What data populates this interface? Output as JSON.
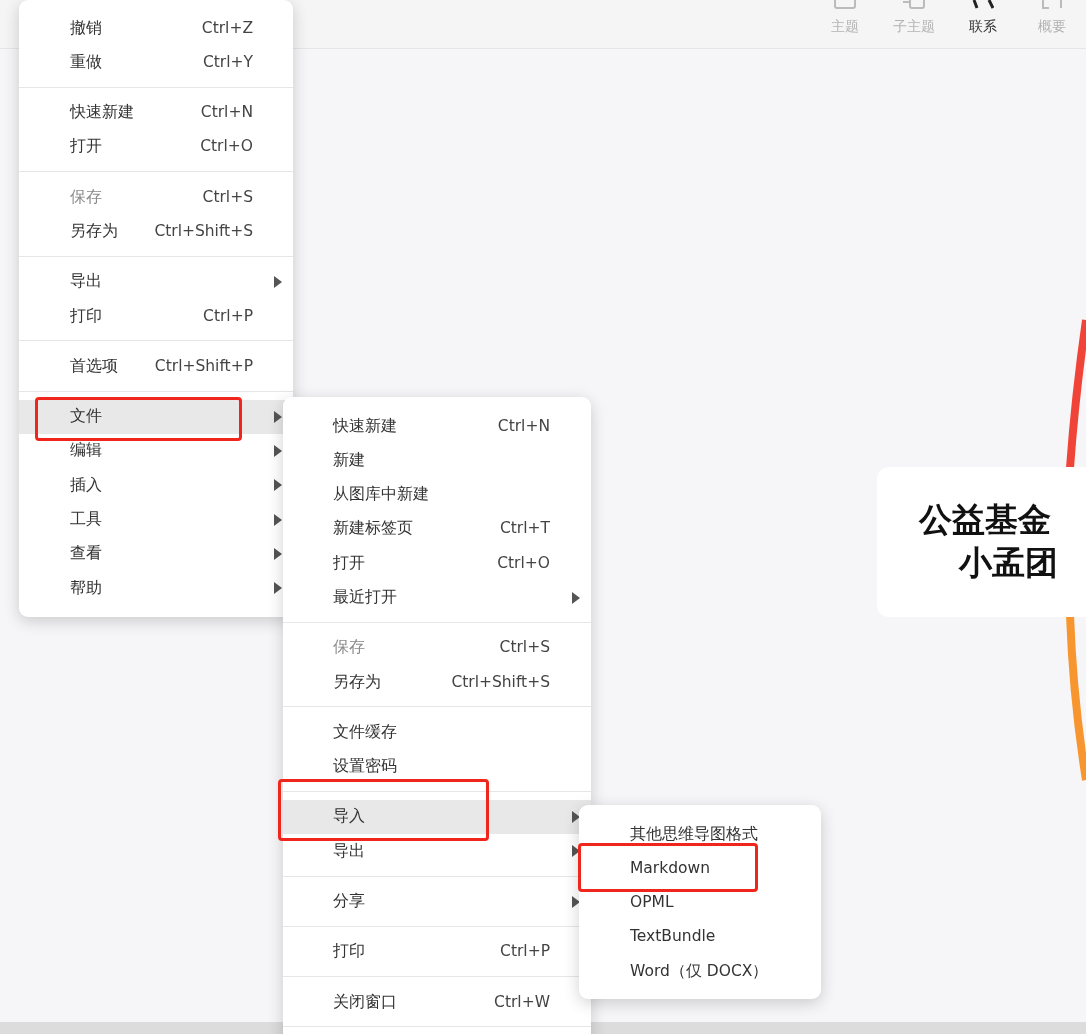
{
  "toolbar": {
    "items": [
      {
        "label": "主题",
        "active": false
      },
      {
        "label": "子主题",
        "active": false
      },
      {
        "label": "联系",
        "active": true
      },
      {
        "label": "概要",
        "active": false
      }
    ]
  },
  "canvas": {
    "node_lines": [
      "公益基金",
      "小孟团"
    ]
  },
  "main_menu": {
    "groups": [
      [
        {
          "label": "撤销",
          "shortcut": "Ctrl+Z",
          "disabled": false,
          "submenu": false,
          "highlighted": false,
          "outlined": false
        },
        {
          "label": "重做",
          "shortcut": "Ctrl+Y",
          "disabled": false,
          "submenu": false,
          "highlighted": false,
          "outlined": false
        }
      ],
      [
        {
          "label": "快速新建",
          "shortcut": "Ctrl+N",
          "disabled": false,
          "submenu": false,
          "highlighted": false,
          "outlined": false
        },
        {
          "label": "打开",
          "shortcut": "Ctrl+O",
          "disabled": false,
          "submenu": false,
          "highlighted": false,
          "outlined": false
        }
      ],
      [
        {
          "label": "保存",
          "shortcut": "Ctrl+S",
          "disabled": true,
          "submenu": false,
          "highlighted": false,
          "outlined": false
        },
        {
          "label": "另存为",
          "shortcut": "Ctrl+Shift+S",
          "disabled": false,
          "submenu": false,
          "highlighted": false,
          "outlined": false
        }
      ],
      [
        {
          "label": "导出",
          "disabled": false,
          "submenu": true,
          "highlighted": false,
          "outlined": false
        },
        {
          "label": "打印",
          "shortcut": "Ctrl+P",
          "disabled": false,
          "submenu": false,
          "highlighted": false,
          "outlined": false
        }
      ],
      [
        {
          "label": "首选项",
          "shortcut": "Ctrl+Shift+P",
          "disabled": false,
          "submenu": false,
          "highlighted": false,
          "outlined": false
        }
      ],
      [
        {
          "label": "文件",
          "disabled": false,
          "submenu": true,
          "highlighted": true,
          "outlined": true
        },
        {
          "label": "编辑",
          "disabled": false,
          "submenu": true,
          "highlighted": false,
          "outlined": false
        },
        {
          "label": "插入",
          "disabled": false,
          "submenu": true,
          "highlighted": false,
          "outlined": false
        },
        {
          "label": "工具",
          "disabled": false,
          "submenu": true,
          "highlighted": false,
          "outlined": false
        },
        {
          "label": "查看",
          "disabled": false,
          "submenu": true,
          "highlighted": false,
          "outlined": false
        },
        {
          "label": "帮助",
          "disabled": false,
          "submenu": true,
          "highlighted": false,
          "outlined": false
        }
      ]
    ]
  },
  "file_menu": {
    "groups": [
      [
        {
          "label": "快速新建",
          "shortcut": "Ctrl+N",
          "disabled": false,
          "submenu": false,
          "highlighted": false,
          "outlined": false
        },
        {
          "label": "新建",
          "disabled": false,
          "submenu": false,
          "highlighted": false,
          "outlined": false
        },
        {
          "label": "从图库中新建",
          "disabled": false,
          "submenu": false,
          "highlighted": false,
          "outlined": false
        },
        {
          "label": "新建标签页",
          "shortcut": "Ctrl+T",
          "disabled": false,
          "submenu": false,
          "highlighted": false,
          "outlined": false
        },
        {
          "label": "打开",
          "shortcut": "Ctrl+O",
          "disabled": false,
          "submenu": false,
          "highlighted": false,
          "outlined": false
        },
        {
          "label": "最近打开",
          "disabled": false,
          "submenu": true,
          "highlighted": false,
          "outlined": false
        }
      ],
      [
        {
          "label": "保存",
          "shortcut": "Ctrl+S",
          "disabled": true,
          "submenu": false,
          "highlighted": false,
          "outlined": false
        },
        {
          "label": "另存为",
          "shortcut": "Ctrl+Shift+S",
          "disabled": false,
          "submenu": false,
          "highlighted": false,
          "outlined": false
        }
      ],
      [
        {
          "label": "文件缓存",
          "disabled": false,
          "submenu": false,
          "highlighted": false,
          "outlined": false
        },
        {
          "label": "设置密码",
          "disabled": false,
          "submenu": false,
          "highlighted": false,
          "outlined": false
        }
      ],
      [
        {
          "label": "导入",
          "disabled": false,
          "submenu": true,
          "highlighted": true,
          "outlined": true
        },
        {
          "label": "导出",
          "disabled": false,
          "submenu": true,
          "highlighted": false,
          "outlined": false
        }
      ],
      [
        {
          "label": "分享",
          "disabled": false,
          "submenu": true,
          "highlighted": false,
          "outlined": false
        }
      ],
      [
        {
          "label": "打印",
          "shortcut": "Ctrl+P",
          "disabled": false,
          "submenu": false,
          "highlighted": false,
          "outlined": false
        }
      ],
      [
        {
          "label": "关闭窗口",
          "shortcut": "Ctrl+W",
          "disabled": false,
          "submenu": false,
          "highlighted": false,
          "outlined": false
        }
      ]
    ]
  },
  "import_menu": {
    "groups": [
      [
        {
          "label": "其他思维导图格式",
          "disabled": false,
          "submenu": false,
          "highlighted": false,
          "outlined": false
        },
        {
          "label": "Markdown",
          "disabled": false,
          "submenu": false,
          "highlighted": false,
          "outlined": true
        },
        {
          "label": "OPML",
          "disabled": false,
          "submenu": false,
          "highlighted": false,
          "outlined": false
        },
        {
          "label": "TextBundle",
          "disabled": false,
          "submenu": false,
          "highlighted": false,
          "outlined": false
        },
        {
          "label": "Word（仅 DOCX）",
          "disabled": false,
          "submenu": false,
          "highlighted": false,
          "outlined": false
        }
      ]
    ]
  }
}
